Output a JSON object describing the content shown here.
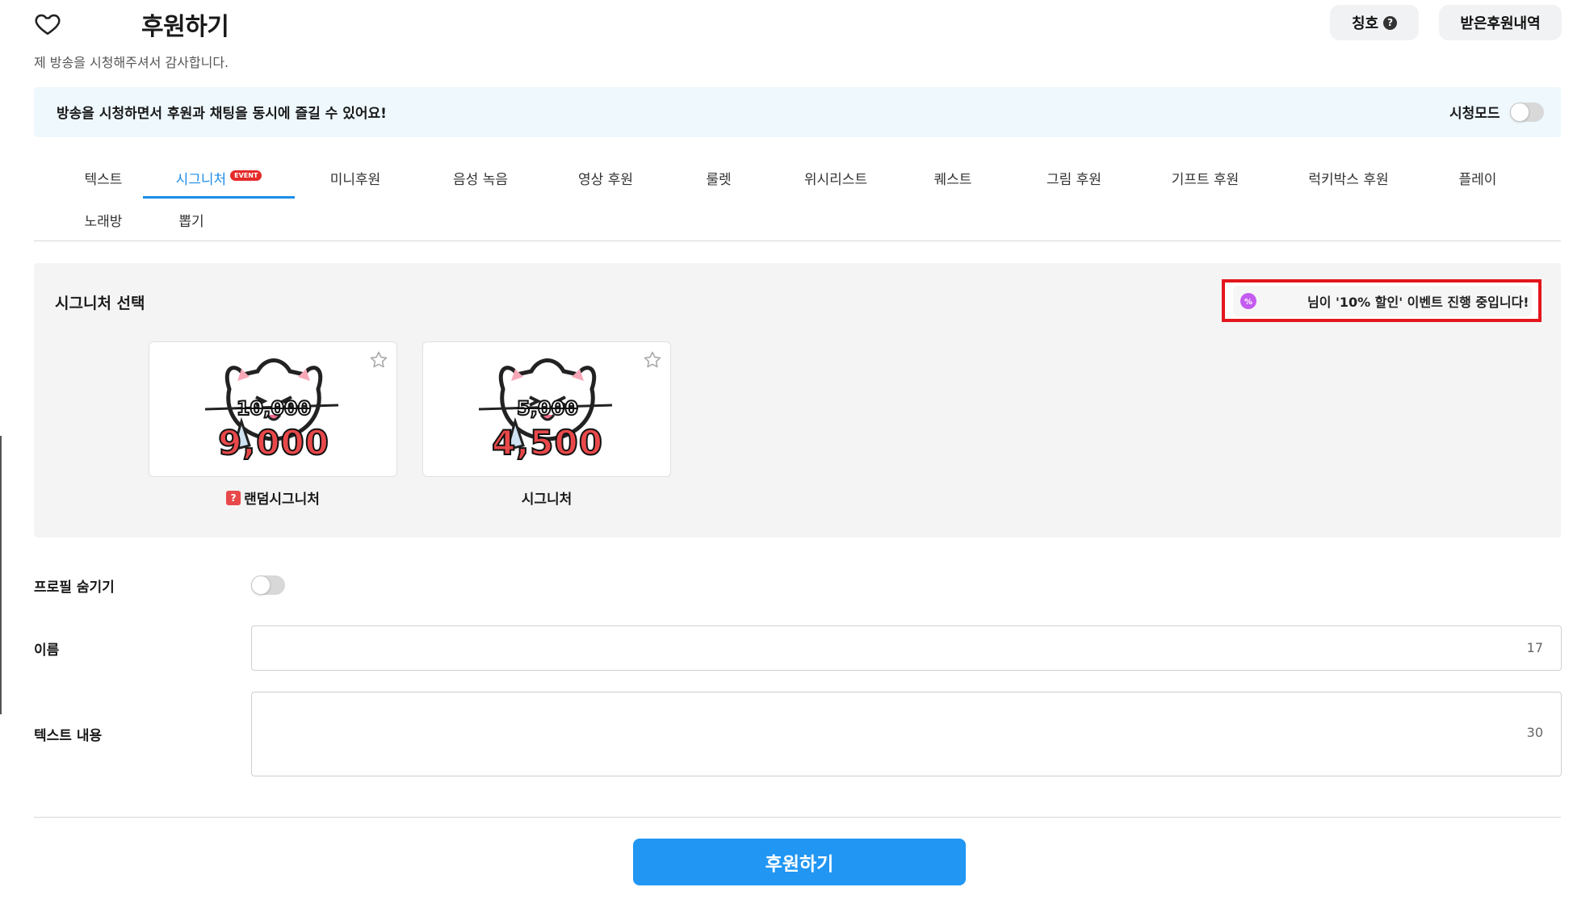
{
  "header": {
    "title": "후원하기",
    "subtitle": "제 방송을 시청해주셔서 감사합니다.",
    "title_button": "칭호",
    "history_button": "받은후원내역"
  },
  "banner": {
    "text": "방송을 시청하면서 후원과 채팅을 동시에 즐길 수 있어요!",
    "viewmode_label": "시청모드",
    "viewmode_on": false
  },
  "tabs": [
    {
      "label": "텍스트",
      "active": false
    },
    {
      "label": "시그니처",
      "active": true,
      "badge": "EVENT"
    },
    {
      "label": "미니후원",
      "active": false
    },
    {
      "label": "음성 녹음",
      "active": false
    },
    {
      "label": "영상 후원",
      "active": false
    },
    {
      "label": "룰렛",
      "active": false
    },
    {
      "label": "위시리스트",
      "active": false
    },
    {
      "label": "퀘스트",
      "active": false
    },
    {
      "label": "그림 후원",
      "active": false
    },
    {
      "label": "기프트 후원",
      "active": false
    },
    {
      "label": "럭키박스 후원",
      "active": false
    },
    {
      "label": "플레이",
      "active": false
    },
    {
      "label": "노래방",
      "active": false
    },
    {
      "label": "뽑기",
      "active": false
    }
  ],
  "signature": {
    "heading": "시그니처 선택",
    "event_text": "님이 '10% 할인' 이벤트 진행 중입니다!",
    "cards": [
      {
        "old_price": "10,000",
        "new_price": "9,000",
        "label": "랜덤시그니처",
        "label_badge": "?"
      },
      {
        "old_price": "5,000",
        "new_price": "4,500",
        "label": "시그니처"
      }
    ]
  },
  "form": {
    "profile_hide_label": "프로필 숨기기",
    "profile_hide_on": false,
    "name_label": "이름",
    "name_value": "",
    "name_counter": "17",
    "text_label": "텍스트 내용",
    "text_value": "",
    "text_counter": "30"
  },
  "submit_label": "후원하기",
  "colors": {
    "accent": "#2196f3",
    "tab_active": "#1d8de8",
    "price_red": "#e8484a",
    "event_border": "#e4161c",
    "banner_bg": "#eef8fd"
  }
}
